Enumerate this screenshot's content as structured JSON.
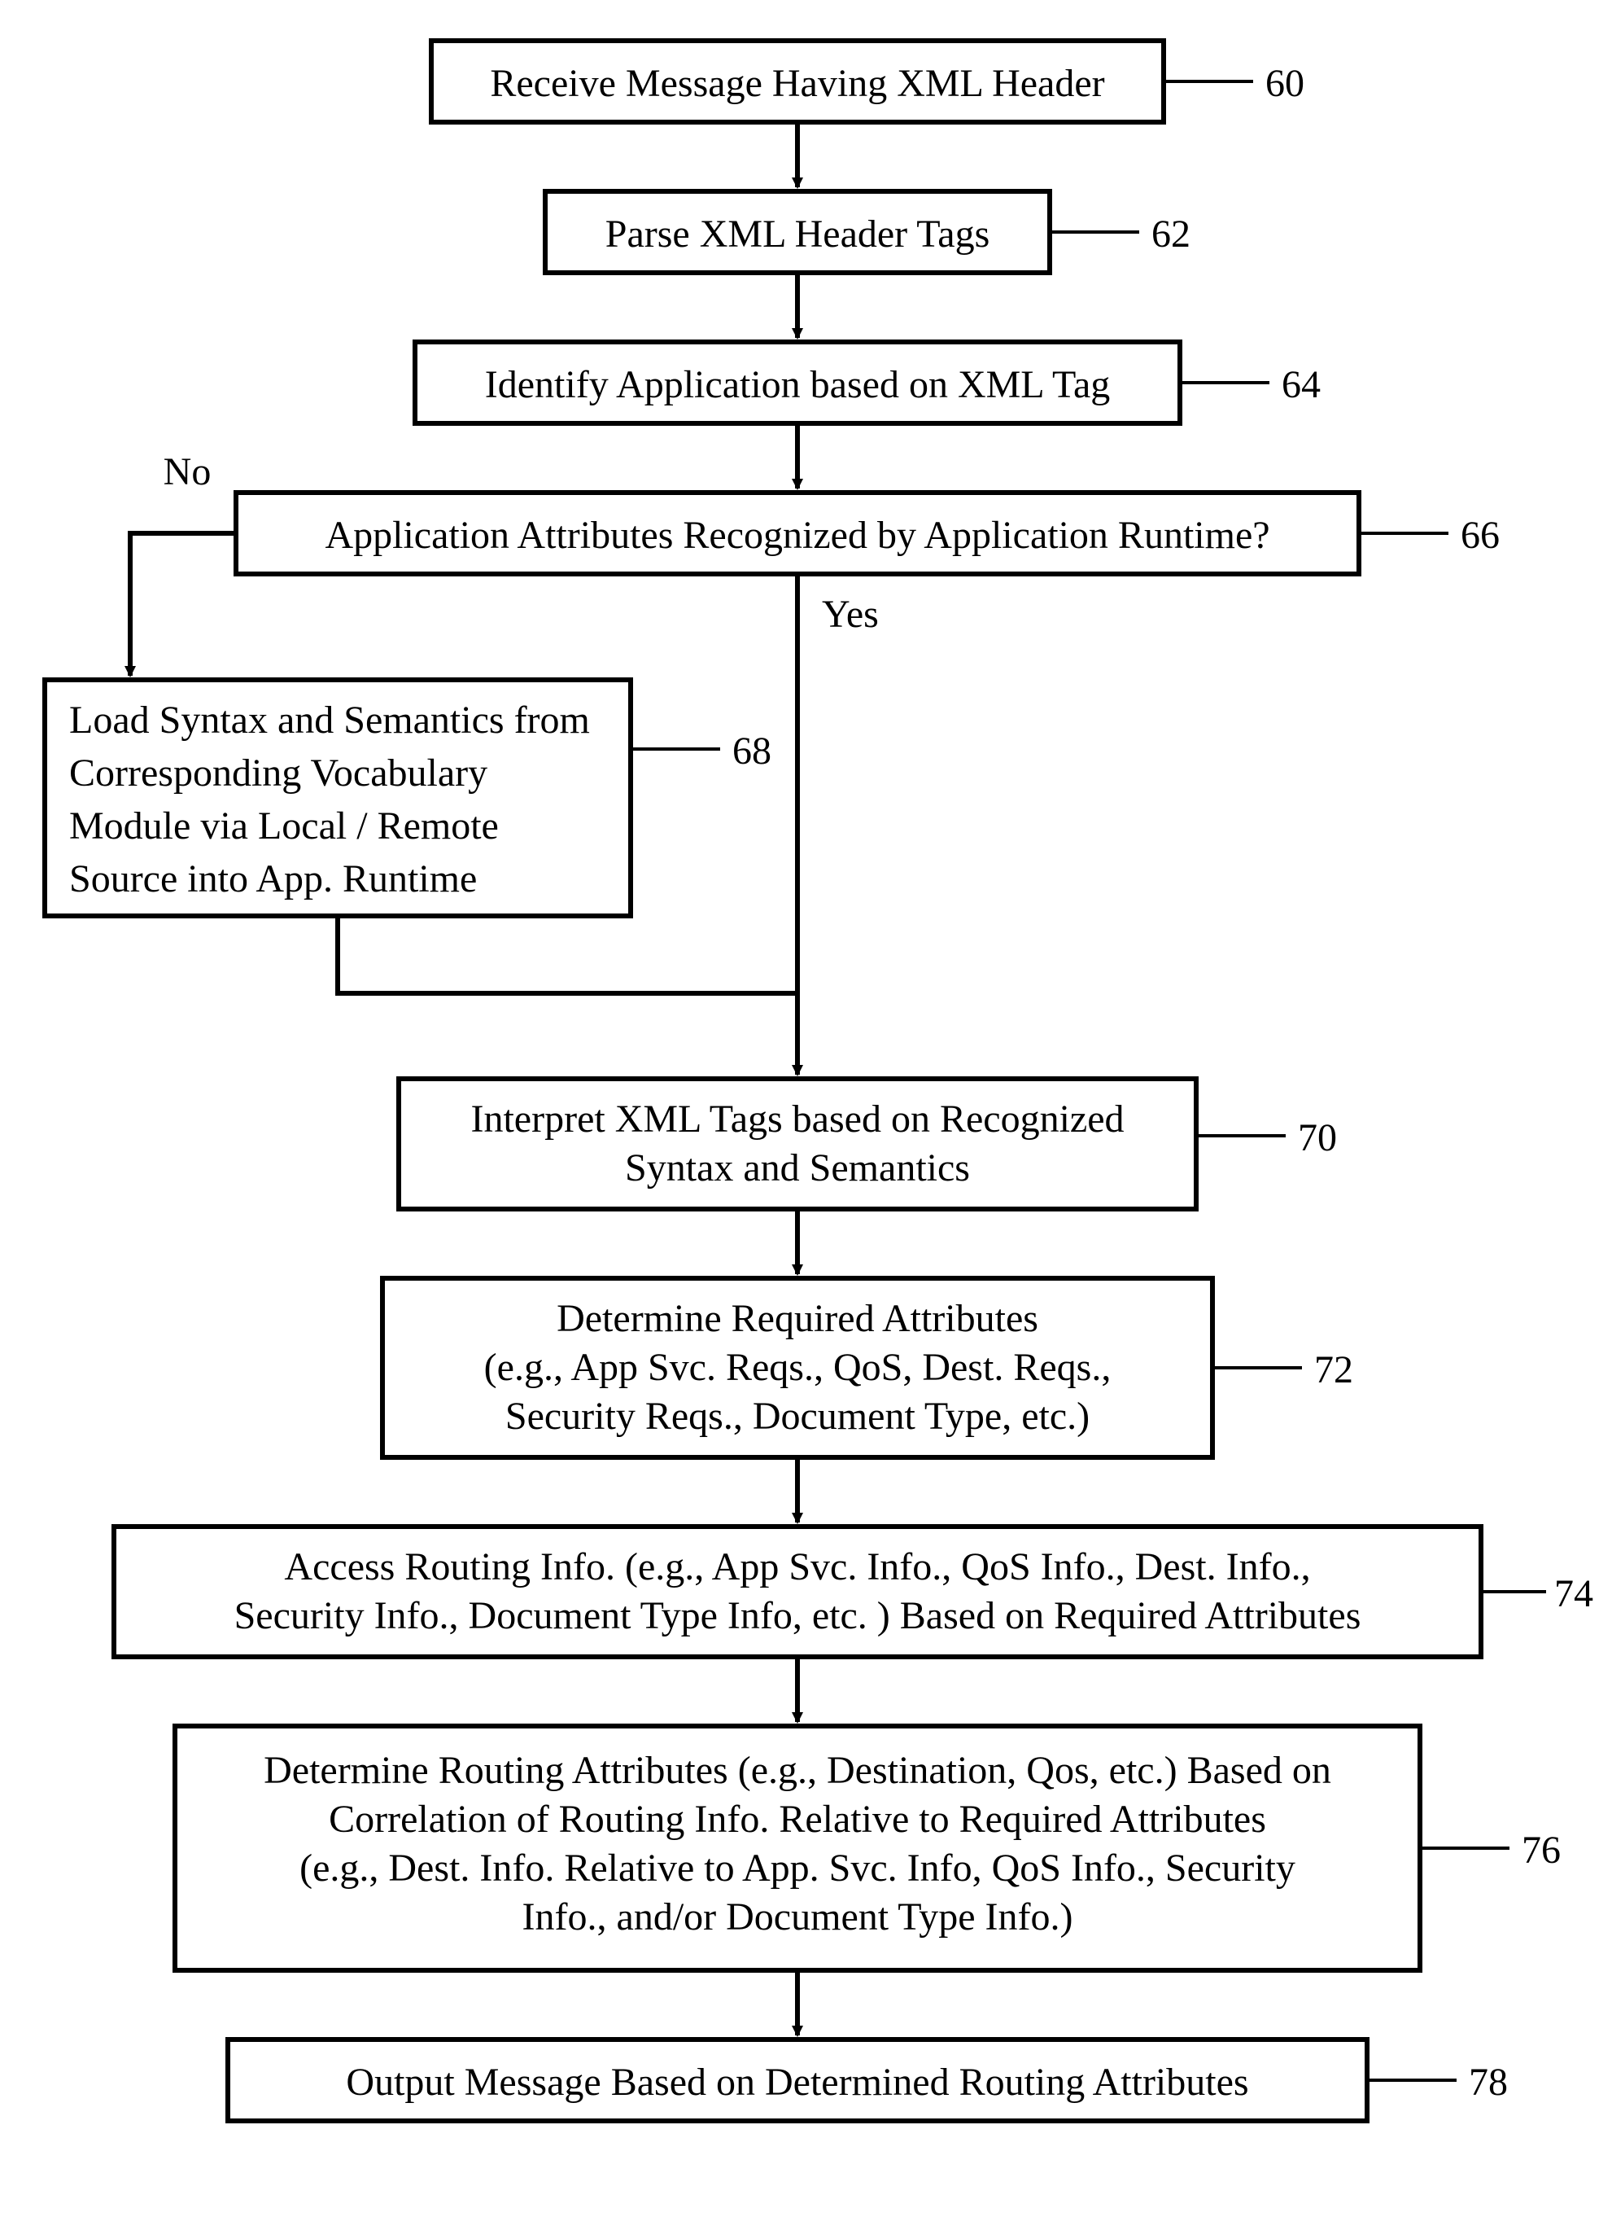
{
  "nodes": {
    "n60": {
      "text": "Receive Message Having XML Header",
      "num": "60"
    },
    "n62": {
      "text": "Parse XML Header Tags",
      "num": "62"
    },
    "n64": {
      "text": "Identify Application based on XML Tag",
      "num": "64"
    },
    "n66": {
      "text": "Application Attributes Recognized by Application Runtime?",
      "num": "66"
    },
    "n68": {
      "line1": "Load Syntax and Semantics from",
      "line2": "Corresponding Vocabulary",
      "line3": "Module via Local / Remote",
      "line4": "Source into App. Runtime",
      "num": "68"
    },
    "n70": {
      "line1": "Interpret XML Tags based on Recognized",
      "line2": "Syntax and Semantics",
      "num": "70"
    },
    "n72": {
      "line1": "Determine Required Attributes",
      "line2": "(e.g., App Svc. Reqs., QoS, Dest. Reqs.,",
      "line3": "Security Reqs., Document Type, etc.)",
      "num": "72"
    },
    "n74": {
      "line1": "Access Routing Info. (e.g., App Svc. Info., QoS Info., Dest. Info.,",
      "line2": "Security Info., Document Type Info, etc. ) Based on Required Attributes",
      "num": "74"
    },
    "n76": {
      "line1": "Determine Routing Attributes (e.g., Destination, Qos, etc.) Based on",
      "line2": "Correlation of Routing Info. Relative to Required Attributes",
      "line3": "(e.g., Dest. Info. Relative to App. Svc. Info, QoS Info., Security",
      "line4": "Info., and/or Document Type Info.)",
      "num": "76"
    },
    "n78": {
      "text": "Output Message Based on Determined Routing Attributes",
      "num": "78"
    }
  },
  "labels": {
    "no": "No",
    "yes": "Yes"
  }
}
